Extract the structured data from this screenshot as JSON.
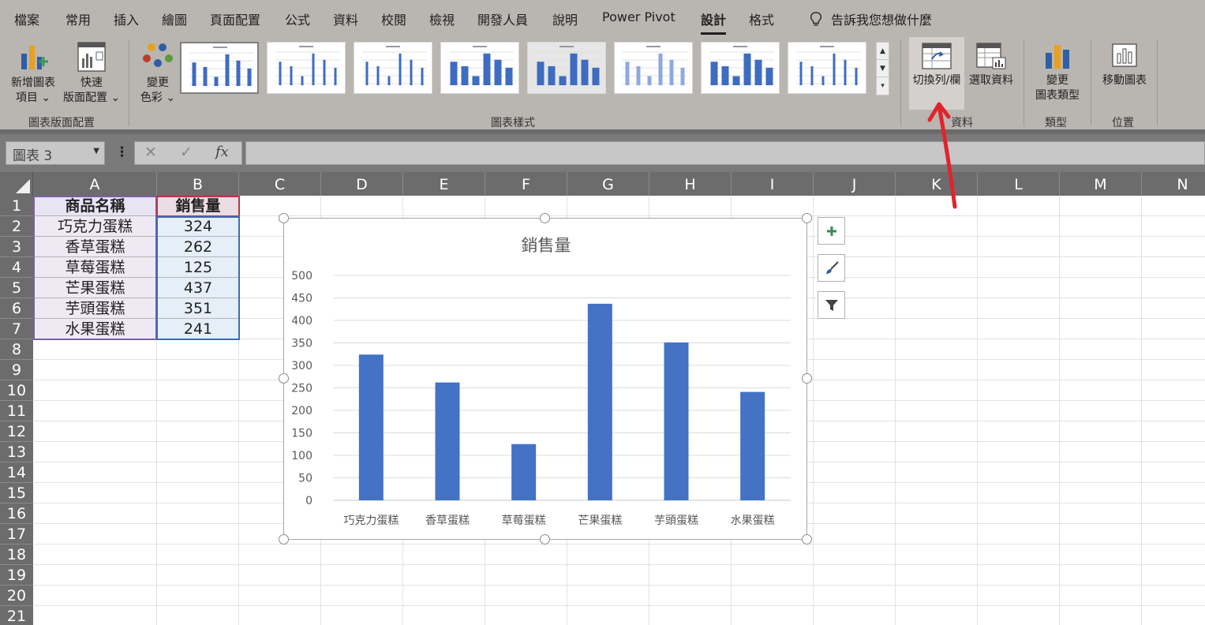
{
  "ribbon": {
    "tabs": [
      "檔案",
      "常用",
      "插入",
      "繪圖",
      "頁面配置",
      "公式",
      "資料",
      "校閱",
      "檢視",
      "開發人員",
      "說明",
      "Power Pivot",
      "設計",
      "格式"
    ],
    "active_tab": "設計",
    "tell_me": "告訴我您想做什麼",
    "add_chart_element": {
      "line1": "新增圖表",
      "line2": "項目 ⌄"
    },
    "quick_layout": {
      "line1": "快速",
      "line2": "版面配置 ⌄"
    },
    "change_colors": {
      "line1": "變更",
      "line2": "色彩 ⌄"
    },
    "switch_row_col": "切換列/欄",
    "select_data": "選取資料",
    "change_chart_type": {
      "line1": "變更",
      "line2": "圖表類型"
    },
    "move_chart": "移動圖表",
    "group_labels": {
      "layouts": "圖表版面配置",
      "styles": "圖表樣式",
      "data": "資料",
      "type": "類型",
      "location": "位置"
    }
  },
  "formula_bar": {
    "name_box": "圖表 3",
    "cancel": "✕",
    "enter": "✓",
    "fx": "fx",
    "content": ""
  },
  "columns": [
    "A",
    "B",
    "C",
    "D",
    "E",
    "F",
    "G",
    "H",
    "I",
    "J",
    "K",
    "L",
    "M",
    "N"
  ],
  "rows": [
    "1",
    "2",
    "3",
    "4",
    "5",
    "6",
    "7",
    "8",
    "9",
    "10",
    "11",
    "12",
    "13",
    "14",
    "15",
    "16",
    "17",
    "18",
    "19",
    "20",
    "21"
  ],
  "table": {
    "header": {
      "a": "商品名稱",
      "b": "銷售量"
    },
    "rows": [
      {
        "a": "巧克力蛋糕",
        "b": "324"
      },
      {
        "a": "香草蛋糕",
        "b": "262"
      },
      {
        "a": "草莓蛋糕",
        "b": "125"
      },
      {
        "a": "芒果蛋糕",
        "b": "437"
      },
      {
        "a": "芋頭蛋糕",
        "b": "351"
      },
      {
        "a": "水果蛋糕",
        "b": "241"
      }
    ]
  },
  "chart_data": {
    "type": "bar",
    "title": "銷售量",
    "categories": [
      "巧克力蛋糕",
      "香草蛋糕",
      "草莓蛋糕",
      "芒果蛋糕",
      "芋頭蛋糕",
      "水果蛋糕"
    ],
    "values": [
      324,
      262,
      125,
      437,
      351,
      241
    ],
    "ylim": [
      0,
      500
    ],
    "yticks": [
      "0",
      "50",
      "100",
      "150",
      "200",
      "250",
      "300",
      "350",
      "400",
      "450",
      "500"
    ],
    "grid": true,
    "legend": "none",
    "bar_color": "#4472c4"
  },
  "colors": {
    "ribbon_bg": "#b9b5b1",
    "header_bg": "#6c6c6c",
    "annotation_arrow": "#e0242a"
  }
}
